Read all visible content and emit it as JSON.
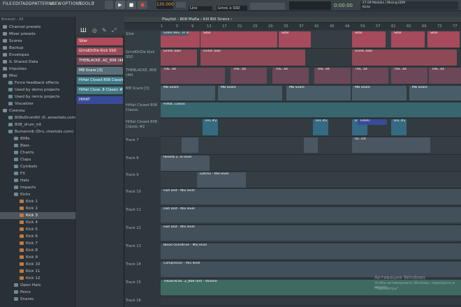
{
  "menu": {
    "file": "FILE",
    "edit": "EDIT",
    "add": "ADD",
    "patterns": "PATTERNS",
    "view": "VIEW",
    "options": "OPTIONS",
    "tools": "TOOLS",
    "help": "?"
  },
  "transport": {
    "tempo": "130.000",
    "line_mode": "Line",
    "preset": "Grind..k SSD",
    "time": "0:00:00",
    "hint_line1": "27.09 Madalia | Mixing.EDM",
    "hint_line2": "Kicks"
  },
  "browser": {
    "header": "Browser - All",
    "items": [
      {
        "label": "Channel presets",
        "indent": 0
      },
      {
        "label": "Mixer presets",
        "indent": 0
      },
      {
        "label": "Scores",
        "indent": 0
      },
      {
        "label": "Backup",
        "indent": 0
      },
      {
        "label": "Envelopes",
        "indent": 0
      },
      {
        "label": "IL Shared Data",
        "indent": 0
      },
      {
        "label": "Impulses",
        "indent": 0
      },
      {
        "label": "Misc",
        "indent": 0
      },
      {
        "label": "Force feedback effects",
        "indent": 1
      },
      {
        "label": "Used by demo projects",
        "indent": 1
      },
      {
        "label": "Used by remix projects",
        "indent": 1
      },
      {
        "label": "Visualizer",
        "indent": 1
      },
      {
        "label": "Сэмплы",
        "indent": 0
      },
      {
        "label": "808sDrumKit (Il..amentals.com)",
        "indent": 1
      },
      {
        "label": "808_drum_kit",
        "indent": 1
      },
      {
        "label": "Bumennik (Dru..mentals.com)",
        "indent": 1
      },
      {
        "label": "808s",
        "indent": 2
      },
      {
        "label": "Bass",
        "indent": 2
      },
      {
        "label": "Chants",
        "indent": 2
      },
      {
        "label": "Claps",
        "indent": 2
      },
      {
        "label": "Cymbals",
        "indent": 2
      },
      {
        "label": "FX",
        "indent": 2
      },
      {
        "label": "Hats",
        "indent": 2
      },
      {
        "label": "Impacts",
        "indent": 2
      },
      {
        "label": "Kicks",
        "indent": 2
      },
      {
        "label": "Kick 1",
        "indent": 3
      },
      {
        "label": "Kick 2",
        "indent": 3
      },
      {
        "label": "Kick 3",
        "indent": 3
      },
      {
        "label": "Kick 4",
        "indent": 3
      },
      {
        "label": "Kick 5",
        "indent": 3
      },
      {
        "label": "Kick 6",
        "indent": 3
      },
      {
        "label": "Kick 7",
        "indent": 3
      },
      {
        "label": "Kick 8",
        "indent": 3
      },
      {
        "label": "Kick 9",
        "indent": 3
      },
      {
        "label": "Kick 10",
        "indent": 3
      },
      {
        "label": "Kick 11",
        "indent": 3
      },
      {
        "label": "Kick 12",
        "indent": 3
      },
      {
        "label": "Open Hats",
        "indent": 2
      },
      {
        "label": "Percs",
        "indent": 2
      },
      {
        "label": "Snares",
        "indent": 2
      }
    ],
    "selected": "Kick 3"
  },
  "channels": [
    {
      "label": "Sitar",
      "color": "#b04a5a"
    },
    {
      "label": "GrindOrDie Kick SSD",
      "color": "#9e4a56"
    },
    {
      "label": "THEBLACKE..AZ_808 (44)",
      "color": "#7a4a58"
    },
    {
      "label": "MB Snare [3]",
      "color": "#5a6e7a"
    },
    {
      "label": "HiHat Closed 808 Classic",
      "color": "#3f7a86"
    },
    {
      "label": "HiHat Close..8 Classic #2",
      "color": "#3f7a86"
    },
    {
      "label": "HIHAT",
      "color": "#3a4a9a"
    }
  ],
  "playlist": {
    "title": "Playlist - 808 Mafia › Kill Bill Sirens ›",
    "ruler": [
      "1",
      "5",
      "9",
      "13",
      "17",
      "21",
      "25",
      "29",
      "33",
      "37",
      "41",
      "45",
      "49",
      "53",
      "57",
      "61",
      "65",
      "69",
      "73",
      "77"
    ],
    "tracks": [
      "Sitar",
      "GrindOrDie Kick SSD",
      "THEBLACKE..808 (44)",
      "MB Snare [3]",
      "HiHat Closed 808 Classic",
      "HiHat Closed 808 Classic #2",
      "Track 7",
      "Track 8",
      "Track 9",
      "Track 10",
      "Track 11",
      "Track 12",
      "Track 13",
      "Track 14",
      "Track 15",
      "Track 16"
    ],
    "clip_labels": {
      "sitar": "Sitar",
      "grind": "Grind..SSD",
      "the": "THE..44",
      "mb": "MB Snare",
      "hh": "HiHat..Classic",
      "hh2": "HH..#2",
      "hihat": "HIHAT",
      "gross": "Gross Rev.. in level",
      "reverb": "Reverb 2..in level",
      "glitch": "Glitch2 - Mix level",
      "sir": "Sir..irst",
      "glitch_mid": "Glitch2 - Mix level",
      "fast": "Fast Dist - Mix level",
      "blood": "Blood Overdrive - Mix level",
      "compressor": "Compressor - Mix level",
      "volume": "THEBLACKE..Z_808 (44) - Volume"
    }
  },
  "watermark": {
    "line1": "Активация Windows",
    "line2": "Чтобы активировать Windows, перейдите в раздел",
    "line3": "\"Параметры\"."
  }
}
